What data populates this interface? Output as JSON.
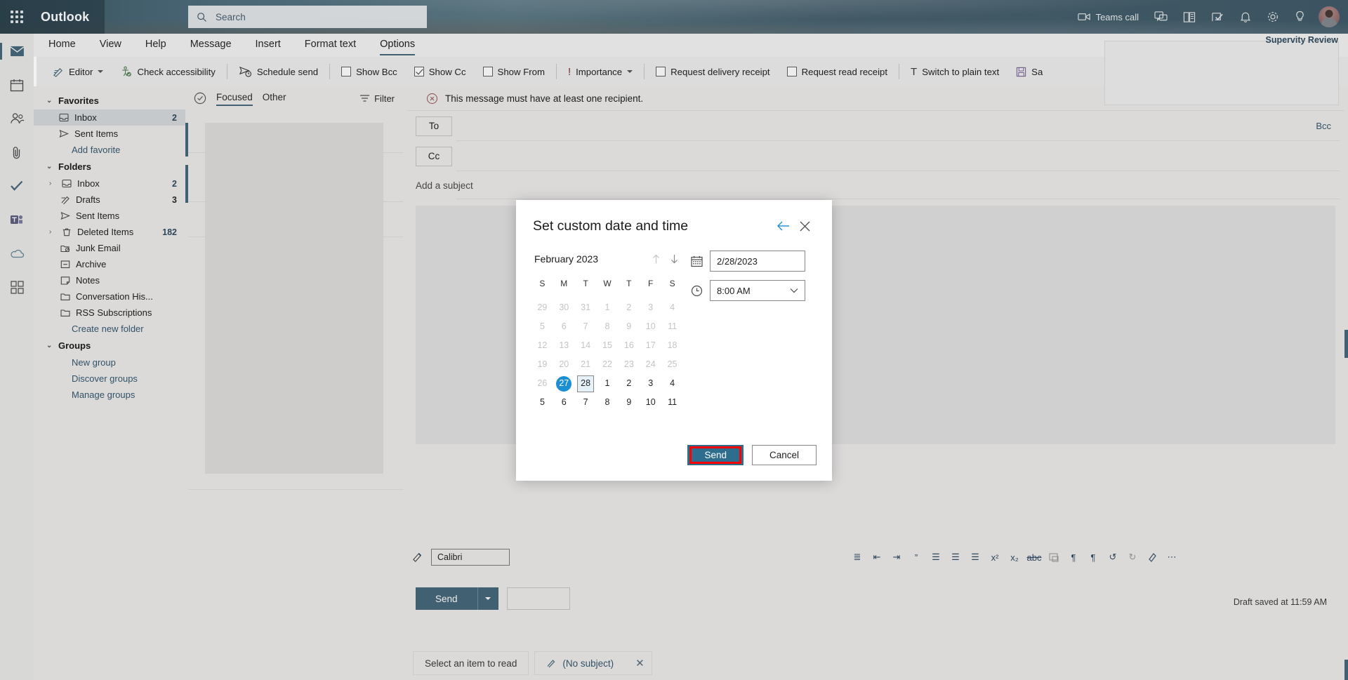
{
  "app": {
    "brand": "Outlook",
    "supervity_label": "Supervity Review"
  },
  "search": {
    "placeholder": "Search",
    "value": "",
    "icon": "search-icon"
  },
  "topbar_right": {
    "teams_call": "Teams call",
    "icons": [
      "video-camera-icon",
      "chat-icon",
      "office-apps-icon",
      "tasks-icon",
      "bell-icon",
      "gear-icon",
      "lightbulb-icon",
      "avatar"
    ]
  },
  "ribbon_tabs": [
    {
      "label": "Home",
      "active": false
    },
    {
      "label": "View",
      "active": false
    },
    {
      "label": "Help",
      "active": false
    },
    {
      "label": "Message",
      "active": false
    },
    {
      "label": "Insert",
      "active": false
    },
    {
      "label": "Format text",
      "active": false
    },
    {
      "label": "Options",
      "active": true
    }
  ],
  "ribbon_commands": [
    {
      "label": "Editor",
      "icon": "editor-icon",
      "type": "dropdown"
    },
    {
      "label": "Check accessibility",
      "icon": "accessibility-icon",
      "type": "button"
    },
    {
      "sep": true
    },
    {
      "label": "Schedule send",
      "icon": "schedule-send-icon",
      "type": "button"
    },
    {
      "sep": true
    },
    {
      "label": "Show Bcc",
      "icon": "checkbox",
      "checked": false,
      "type": "checkbox"
    },
    {
      "label": "Show Cc",
      "icon": "checkbox",
      "checked": true,
      "type": "checkbox"
    },
    {
      "label": "Show From",
      "icon": "checkbox",
      "checked": false,
      "type": "checkbox"
    },
    {
      "sep": true
    },
    {
      "label": "Importance",
      "icon": "importance-icon",
      "type": "dropdown"
    },
    {
      "sep": true
    },
    {
      "label": "Request delivery receipt",
      "icon": "checkbox",
      "checked": false,
      "type": "checkbox"
    },
    {
      "label": "Request read receipt",
      "icon": "checkbox",
      "checked": false,
      "type": "checkbox"
    },
    {
      "sep": true
    },
    {
      "label": "Switch to plain text",
      "icon": "plain-text-icon",
      "type": "button"
    },
    {
      "label": "Sa",
      "icon": "save-icon",
      "type": "button"
    }
  ],
  "rail": [
    {
      "name": "mail-icon",
      "active": true
    },
    {
      "name": "calendar-icon",
      "active": false
    },
    {
      "name": "people-icon",
      "active": false
    },
    {
      "name": "attachment-icon",
      "active": false
    },
    {
      "name": "todo-icon",
      "active": false
    },
    {
      "name": "teams-icon",
      "active": false
    },
    {
      "name": "onedrive-icon",
      "active": false
    },
    {
      "name": "apps-icon",
      "active": false
    }
  ],
  "folders": {
    "favorites_label": "Favorites",
    "favorites": [
      {
        "label": "Inbox",
        "count": "2",
        "icon": "inbox-icon",
        "selected": true
      },
      {
        "label": "Sent Items",
        "count": "",
        "icon": "sent-icon",
        "selected": false
      }
    ],
    "add_favorite": "Add favorite",
    "folders_label": "Folders",
    "items": [
      {
        "label": "Inbox",
        "count": "2",
        "icon": "inbox-icon",
        "expandable": true
      },
      {
        "label": "Drafts",
        "count": "3",
        "icon": "drafts-icon",
        "expandable": false
      },
      {
        "label": "Sent Items",
        "count": "",
        "icon": "sent-icon",
        "expandable": false
      },
      {
        "label": "Deleted Items",
        "count": "182",
        "icon": "trash-icon",
        "expandable": true
      },
      {
        "label": "Junk Email",
        "count": "",
        "icon": "junk-icon",
        "expandable": false
      },
      {
        "label": "Archive",
        "count": "",
        "icon": "archive-icon",
        "expandable": false
      },
      {
        "label": "Notes",
        "count": "",
        "icon": "notes-icon",
        "expandable": false
      },
      {
        "label": "Conversation His...",
        "count": "",
        "icon": "folder-icon",
        "expandable": false
      },
      {
        "label": "RSS Subscriptions",
        "count": "",
        "icon": "folder-icon",
        "expandable": false
      }
    ],
    "create_new_folder": "Create new folder",
    "groups_label": "Groups",
    "group_links": [
      "New group",
      "Discover groups",
      "Manage groups"
    ]
  },
  "message_list": {
    "tabs": [
      {
        "label": "Focused",
        "active": true
      },
      {
        "label": "Other",
        "active": false
      }
    ],
    "filter": "Filter",
    "select_icon": "select-all-icon",
    "filter_icon": "filter-icon"
  },
  "compose": {
    "warning": "This message must have at least one recipient.",
    "to_label": "To",
    "cc_label": "Cc",
    "bcc_link": "Bcc",
    "to_value": "",
    "cc_value": "",
    "subject_placeholder": "Add a subject",
    "subject_value": "",
    "font_name": "Calibri",
    "send_label": "Send",
    "draft_saved": "Draft saved at 11:59 AM",
    "format_icons": [
      "numbered-list-icon",
      "decrease-indent-icon",
      "increase-indent-icon",
      "quote-icon",
      "align-left-icon",
      "align-center-icon",
      "align-right-icon",
      "superscript-icon",
      "subscript-icon",
      "strikethrough-icon",
      "insert-picture-icon",
      "ltr-icon",
      "rtl-icon",
      "undo-icon",
      "redo-icon",
      "clear-formatting-icon",
      "more-options-icon"
    ]
  },
  "footer": {
    "reading_pane": "Select an item to read",
    "draft_tab": "(No subject)",
    "draft_icon": "pencil-icon",
    "close_icon": "close-icon"
  },
  "modal": {
    "title": "Set custom date and time",
    "back_icon": "back-arrow-icon",
    "close_icon": "close-icon",
    "calendar": {
      "month_label": "February 2023",
      "prev_icon": "arrow-up-icon",
      "next_icon": "arrow-down-icon",
      "day_headers": [
        "S",
        "M",
        "T",
        "W",
        "T",
        "F",
        "S"
      ],
      "weeks": [
        [
          {
            "d": "29",
            "state": "muted"
          },
          {
            "d": "30",
            "state": "muted"
          },
          {
            "d": "31",
            "state": "muted"
          },
          {
            "d": "1",
            "state": "muted"
          },
          {
            "d": "2",
            "state": "muted"
          },
          {
            "d": "3",
            "state": "muted"
          },
          {
            "d": "4",
            "state": "muted"
          }
        ],
        [
          {
            "d": "5",
            "state": "muted"
          },
          {
            "d": "6",
            "state": "muted"
          },
          {
            "d": "7",
            "state": "muted"
          },
          {
            "d": "8",
            "state": "muted"
          },
          {
            "d": "9",
            "state": "muted"
          },
          {
            "d": "10",
            "state": "muted"
          },
          {
            "d": "11",
            "state": "muted"
          }
        ],
        [
          {
            "d": "12",
            "state": "muted"
          },
          {
            "d": "13",
            "state": "muted"
          },
          {
            "d": "14",
            "state": "muted"
          },
          {
            "d": "15",
            "state": "muted"
          },
          {
            "d": "16",
            "state": "muted"
          },
          {
            "d": "17",
            "state": "muted"
          },
          {
            "d": "18",
            "state": "muted"
          }
        ],
        [
          {
            "d": "19",
            "state": "muted"
          },
          {
            "d": "20",
            "state": "muted"
          },
          {
            "d": "21",
            "state": "muted"
          },
          {
            "d": "22",
            "state": "muted"
          },
          {
            "d": "23",
            "state": "muted"
          },
          {
            "d": "24",
            "state": "muted"
          },
          {
            "d": "25",
            "state": "muted"
          }
        ],
        [
          {
            "d": "26",
            "state": "muted"
          },
          {
            "d": "27",
            "state": "today"
          },
          {
            "d": "28",
            "state": "selected"
          },
          {
            "d": "1",
            "state": "normal"
          },
          {
            "d": "2",
            "state": "normal"
          },
          {
            "d": "3",
            "state": "normal"
          },
          {
            "d": "4",
            "state": "normal"
          }
        ],
        [
          {
            "d": "5",
            "state": "normal"
          },
          {
            "d": "6",
            "state": "normal"
          },
          {
            "d": "7",
            "state": "normal"
          },
          {
            "d": "8",
            "state": "normal"
          },
          {
            "d": "9",
            "state": "normal"
          },
          {
            "d": "10",
            "state": "normal"
          },
          {
            "d": "11",
            "state": "normal"
          }
        ]
      ]
    },
    "date_field": {
      "icon": "calendar-icon",
      "value": "2/28/2023"
    },
    "time_field": {
      "icon": "clock-icon",
      "value": "8:00 AM",
      "chevron": "chevron-down-icon"
    },
    "send_label": "Send",
    "cancel_label": "Cancel",
    "highlight_color": "#ff0000",
    "accent_color": "#2f6d8e",
    "today_color": "#1b8fd1"
  }
}
